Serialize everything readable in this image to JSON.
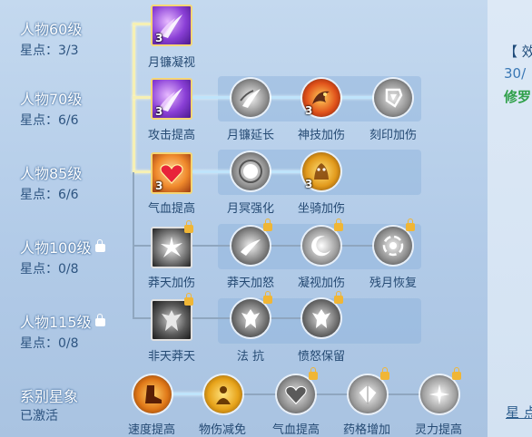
{
  "levels": [
    {
      "name": "人物60级",
      "stars": "星点：3/3",
      "locked": false
    },
    {
      "name": "人物70级",
      "stars": "星点：6/6",
      "locked": false
    },
    {
      "name": "人物85级",
      "stars": "星点：6/6",
      "locked": false
    },
    {
      "name": "人物100级",
      "stars": "星点：0/8",
      "locked": true
    },
    {
      "name": "人物115级",
      "stars": "星点：0/8",
      "locked": true
    }
  ],
  "series": {
    "title": "系别星象",
    "status": "已激活"
  },
  "skills": {
    "yuelian_ningshi": {
      "label": "月镰凝视",
      "count": "3"
    },
    "gongji_tigao": {
      "label": "攻击提高",
      "count": "3"
    },
    "yuelian_yanchang": {
      "label": "月镰延长"
    },
    "shenji_jiashang": {
      "label": "神技加伤",
      "count": "3"
    },
    "keyin_jiashang": {
      "label": "刻印加伤"
    },
    "qixue_tigao": {
      "label": "气血提高",
      "count": "3"
    },
    "yueming_qianghua": {
      "label": "月冥强化"
    },
    "zuoqi_jiashang": {
      "label": "坐骑加伤",
      "count": "3"
    },
    "mangtian_jiashang": {
      "label": "莽天加伤"
    },
    "mangtian_jianu": {
      "label": "莽天加怒"
    },
    "ningshi_jiashang": {
      "label": "凝视加伤"
    },
    "canyue_huifu": {
      "label": "残月恢复"
    },
    "feitian_mangtian": {
      "label": "非天莽天"
    },
    "fa_kang": {
      "label": "法 抗"
    },
    "fennu_baoliu": {
      "label": "愤怒保留"
    },
    "sudu_tigao": {
      "label": "速度提高"
    },
    "wushang_jianmian": {
      "label": "物伤减免"
    },
    "qixue_tigao2": {
      "label": "气血提高"
    },
    "yaoge_zengjia": {
      "label": "药格增加"
    },
    "lingli_tigao": {
      "label": "灵力提高"
    }
  },
  "right_panel": {
    "line1": "【 效",
    "line2": "30/",
    "line3": "修罗",
    "bottom": "星 点"
  }
}
